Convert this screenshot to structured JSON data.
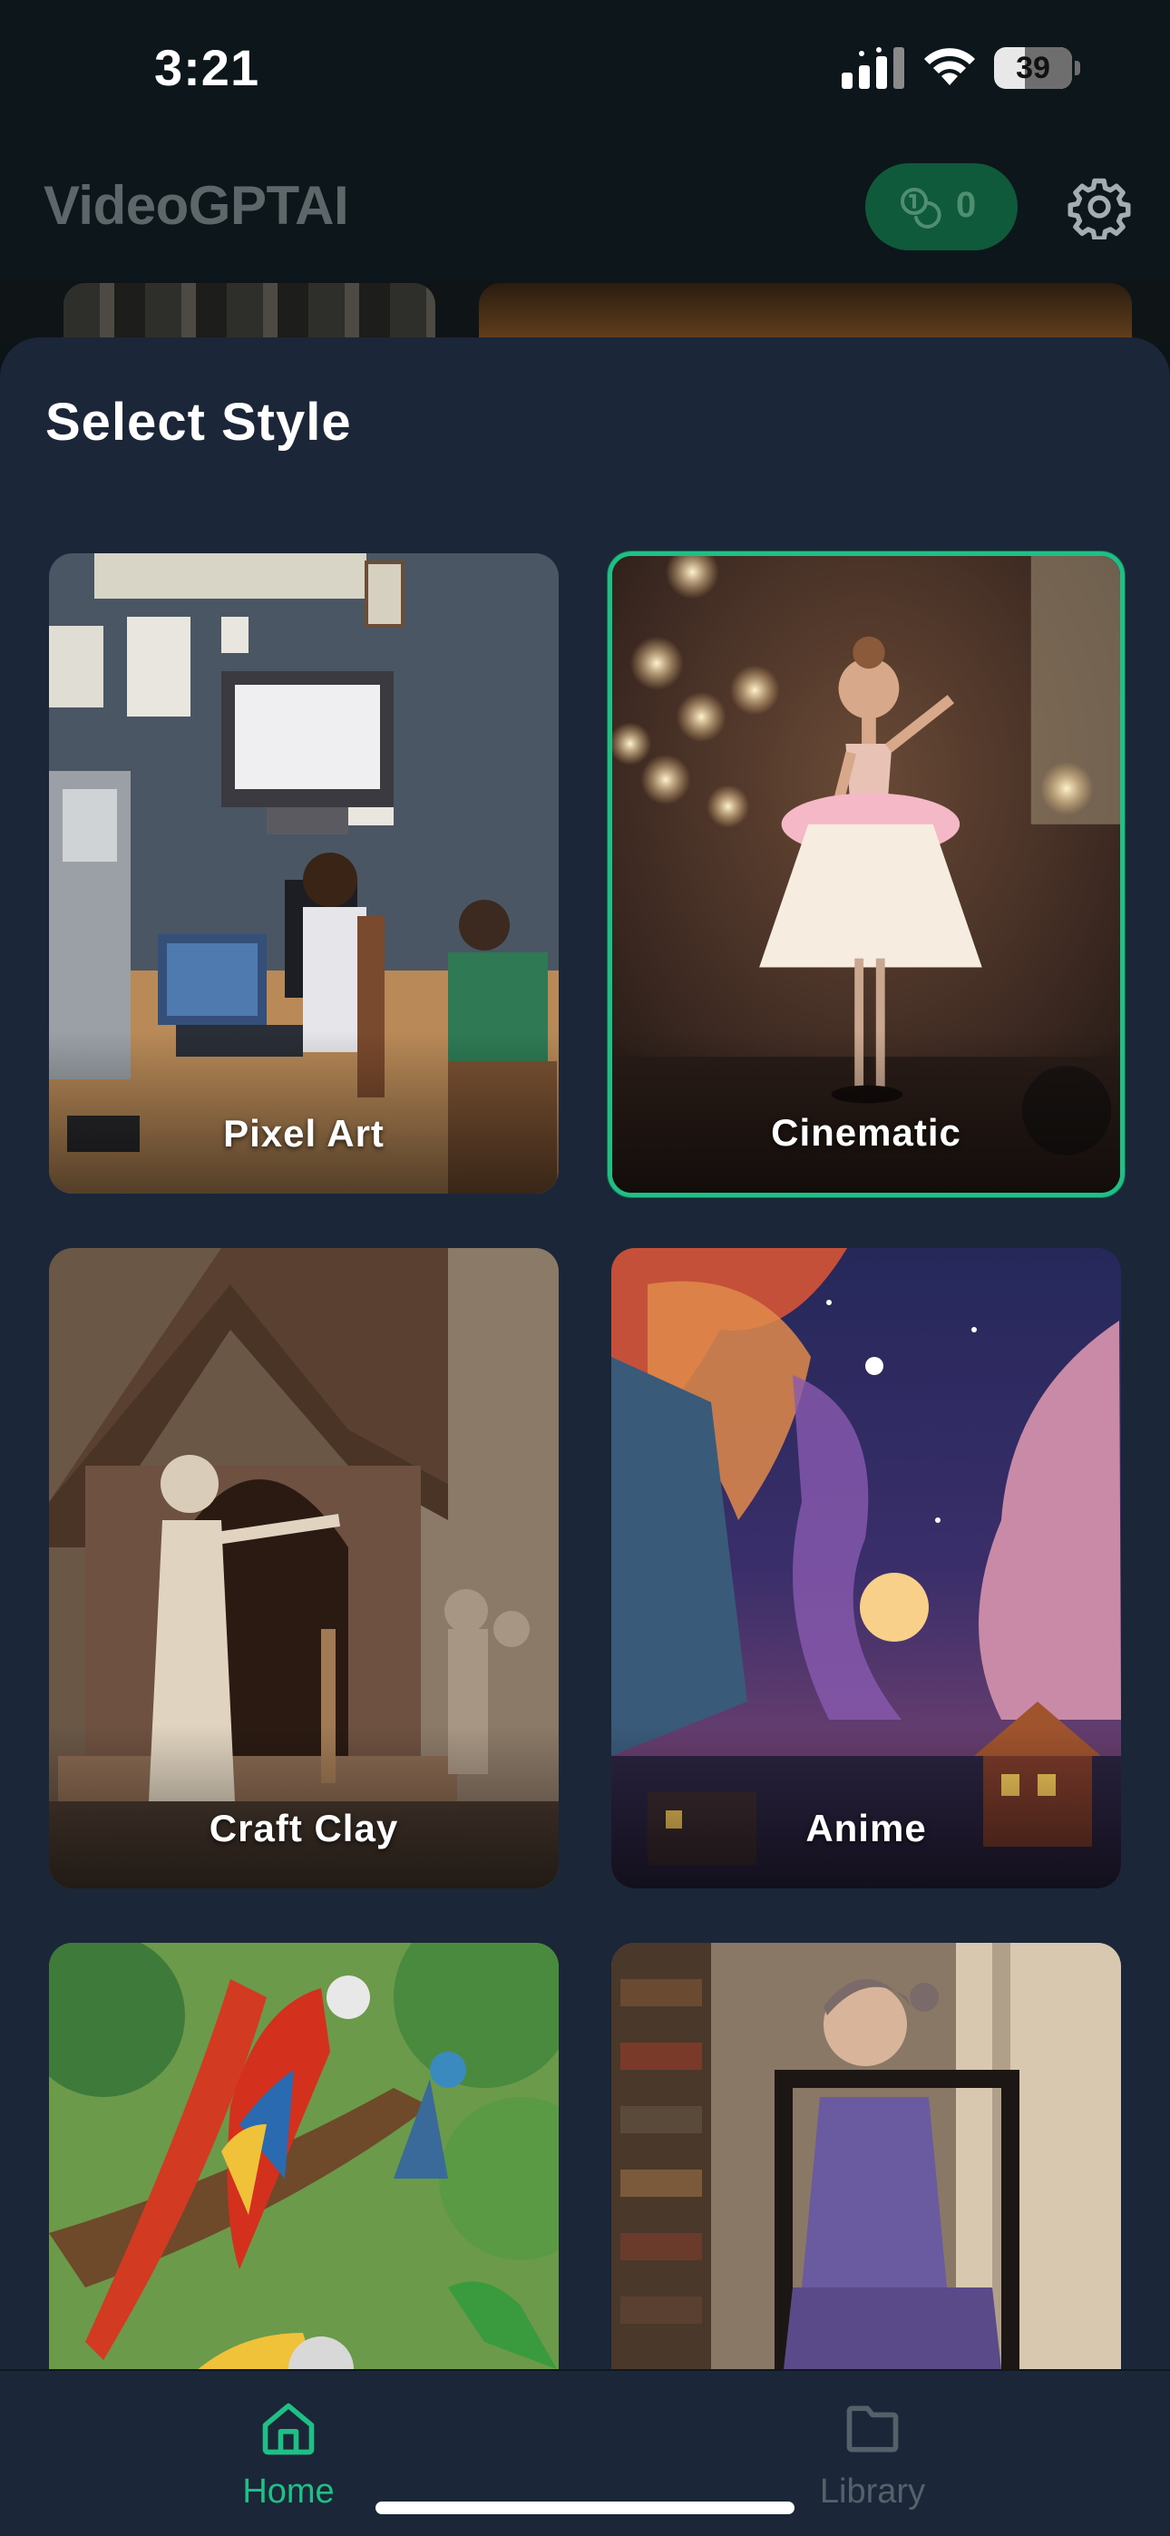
{
  "status_bar": {
    "time": "3:21",
    "battery": "39"
  },
  "header": {
    "app_title": "VideoGPTAI",
    "credits": "0"
  },
  "sheet": {
    "title": "Select Style"
  },
  "styles": [
    {
      "label": "Pixel Art",
      "selected": false
    },
    {
      "label": "Cinematic",
      "selected": true
    },
    {
      "label": "Craft Clay",
      "selected": false
    },
    {
      "label": "Anime",
      "selected": false
    },
    {
      "label": "",
      "selected": false
    },
    {
      "label": "",
      "selected": false
    }
  ],
  "nav": {
    "items": [
      {
        "label": "Home",
        "icon": "home-icon",
        "active": true
      },
      {
        "label": "Library",
        "icon": "folder-icon",
        "active": false
      }
    ]
  },
  "colors": {
    "accent": "#1fbf86",
    "sheet_bg": "#1b2638",
    "header_bg": "#0d171b",
    "credits_bg": "#0f5a3a"
  }
}
